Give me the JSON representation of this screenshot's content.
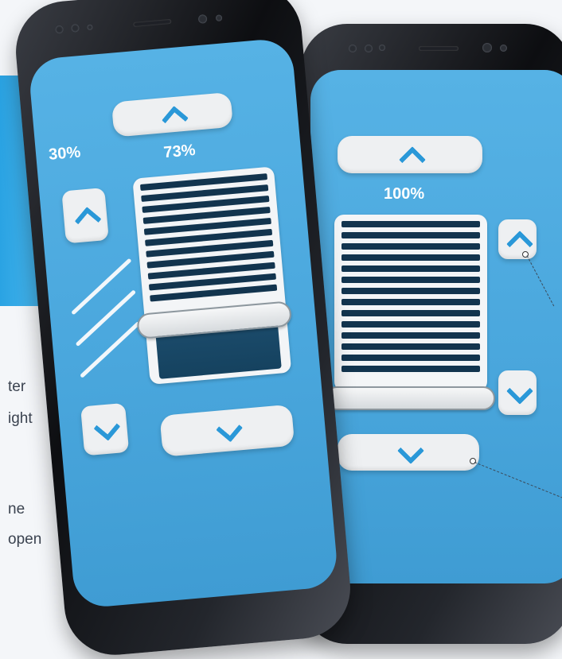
{
  "background": {
    "text_fragments": [
      "ter",
      "ight",
      "ne",
      "open"
    ]
  },
  "phone_left": {
    "left_percent_label": "30%",
    "blind_percent_label": "73%",
    "blind_level_percent": 73,
    "buttons": {
      "up_top": "chevron-up-icon",
      "up_left": "chevron-up-icon",
      "down_left": "chevron-down-icon",
      "down_bottom": "chevron-down-icon"
    }
  },
  "phone_right": {
    "blind_percent_label": "100%",
    "blind_level_percent": 100,
    "buttons": {
      "up_top": "chevron-up-icon",
      "up_right": "chevron-up-icon",
      "down_right": "chevron-down-icon",
      "down_bottom": "chevron-down-icon"
    }
  },
  "colors": {
    "screen_blue": "#4aa7dd",
    "accent_chevron": "#2a98d8",
    "slat_navy": "#12344e",
    "button_bg": "#eef0f2"
  }
}
